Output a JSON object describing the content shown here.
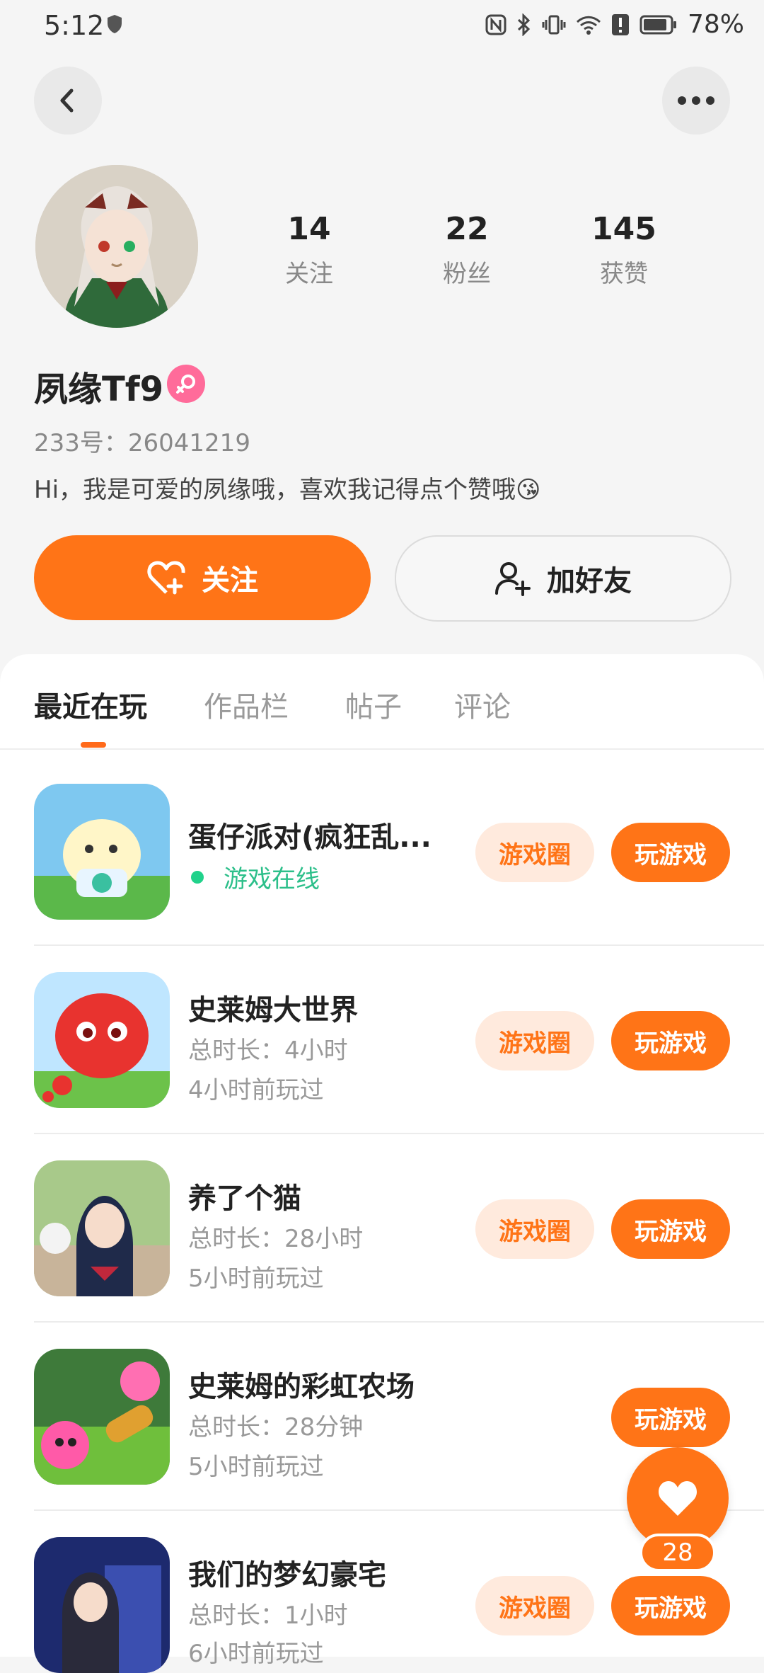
{
  "status_bar": {
    "time": "5:12",
    "battery": "78%"
  },
  "profile": {
    "stats": [
      {
        "value": "14",
        "label": "关注"
      },
      {
        "value": "22",
        "label": "粉丝"
      },
      {
        "value": "145",
        "label": "获赞"
      }
    ],
    "username": "夙缘Tf9",
    "id_text": "233号：26041219",
    "bio": "Hi，我是可爱的夙缘哦，喜欢我记得点个赞哦😘",
    "follow_label": "关注",
    "add_friend_label": "加好友"
  },
  "tabs": [
    {
      "label": "最近在玩",
      "active": true
    },
    {
      "label": "作品栏",
      "active": false
    },
    {
      "label": "帖子",
      "active": false
    },
    {
      "label": "评论",
      "active": false
    }
  ],
  "games": [
    {
      "title": "蛋仔派对(疯狂乱...",
      "status": "游戏在线",
      "circle_label": "游戏圈",
      "play_label": "玩游戏"
    },
    {
      "title": "史莱姆大世界",
      "duration": "总时长：4小时",
      "last_played": "4小时前玩过",
      "circle_label": "游戏圈",
      "play_label": "玩游戏"
    },
    {
      "title": "养了个猫",
      "duration": "总时长：28小时",
      "last_played": "5小时前玩过",
      "circle_label": "游戏圈",
      "play_label": "玩游戏"
    },
    {
      "title": "史莱姆的彩虹农场",
      "duration": "总时长：28分钟",
      "last_played": "5小时前玩过",
      "play_label": "玩游戏"
    },
    {
      "title": "我们的梦幻豪宅",
      "duration": "总时长：1小时",
      "last_played": "6小时前玩过",
      "circle_label": "游戏圈",
      "play_label": "玩游戏"
    }
  ],
  "like_fab": {
    "count": "28"
  },
  "colors": {
    "accent": "#ff7417",
    "accent_soft": "#ffeadd",
    "online": "#2cbf8a",
    "female": "#ff6b9a"
  }
}
